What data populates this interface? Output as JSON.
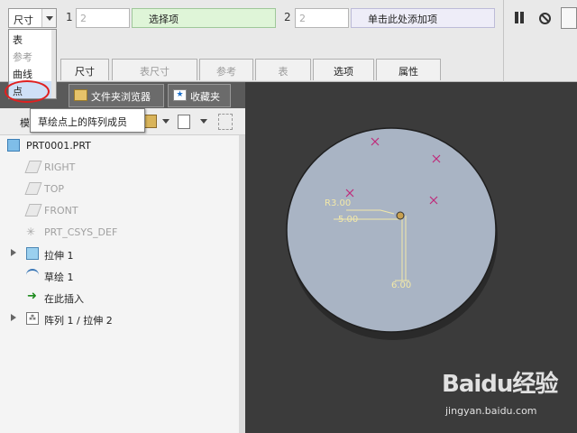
{
  "dashboard": {
    "type_combo_value": "尺寸",
    "ref1_number": "1",
    "ref1_value": "2",
    "collect_items_label": "选择项",
    "ref2_number": "2",
    "ref2_value": "2",
    "click_to_add_label": "单击此处添加项",
    "tabs": [
      "尺寸",
      "表尺寸",
      "参考",
      "表",
      "选项",
      "属性"
    ],
    "disabled_tabs": [
      1,
      2,
      3
    ]
  },
  "dropdown": {
    "items": [
      "表",
      "参考",
      "曲线",
      "点"
    ],
    "disabled_items": [
      1
    ],
    "highlighted_item": 3
  },
  "tooltip": {
    "text": "草绘点上的阵列成员"
  },
  "navigator": {
    "tabs": [
      "文件夹浏览器",
      "收藏夹"
    ],
    "model_tree_label_fragment": "模",
    "tree": [
      {
        "label": "PRT0001.PRT",
        "icon": "part-icon",
        "disabled": false,
        "expandable": false
      },
      {
        "label": "RIGHT",
        "icon": "datum-plane-icon",
        "disabled": true,
        "expandable": false
      },
      {
        "label": "TOP",
        "icon": "datum-plane-icon",
        "disabled": true,
        "expandable": false
      },
      {
        "label": "FRONT",
        "icon": "datum-plane-icon",
        "disabled": true,
        "expandable": false
      },
      {
        "label": "PRT_CSYS_DEF",
        "icon": "csys-icon",
        "disabled": true,
        "expandable": false
      },
      {
        "label": "拉伸 1",
        "icon": "extrude-icon",
        "disabled": false,
        "expandable": true
      },
      {
        "label": "草绘 1",
        "icon": "sketch-icon",
        "disabled": false,
        "expandable": false
      },
      {
        "label": "在此插入",
        "icon": "insert-here-icon",
        "disabled": false,
        "expandable": false
      },
      {
        "label": "阵列 1 / 拉伸 2",
        "icon": "pattern-icon",
        "disabled": false,
        "expandable": true
      }
    ]
  },
  "graphics": {
    "background": "#3b3b3b",
    "disk_color": "#a9b4c4",
    "dimension_color": "#f2e8a8",
    "point_color": "#c0287a",
    "dimensions": {
      "radius": "R3.00",
      "horizontal": "5.00",
      "vertical": "6.00"
    }
  },
  "watermark": {
    "logo": "Baidu经验",
    "url": "jingyan.baidu.com"
  }
}
